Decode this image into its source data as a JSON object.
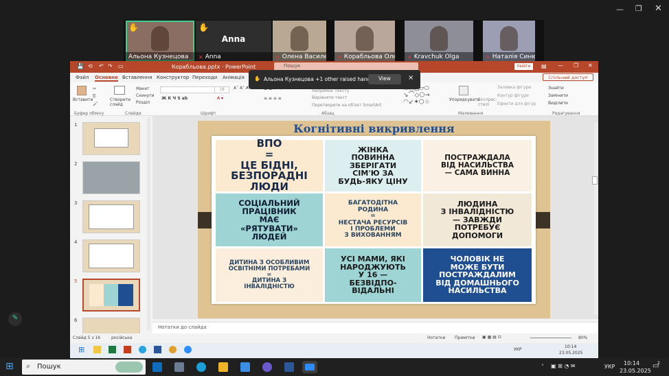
{
  "participants": [
    {
      "name": "Альона Кузнецова",
      "bg": "#8a6e62",
      "hand": true,
      "mic": false
    },
    {
      "name": "Anna",
      "bg": "#2e2e2e",
      "hand": true,
      "mic": true,
      "big": "Anna"
    },
    {
      "name": "Олена Василенко",
      "bg": "#b9a994",
      "hand": false,
      "mic": true
    },
    {
      "name": "Корабльова Олена",
      "bg": "#b8a79a",
      "hand": false,
      "mic": true
    },
    {
      "name": "Kravchuk Olga",
      "bg": "#8d8e98",
      "hand": false,
      "mic": true
    },
    {
      "name": "Наталія Синюк",
      "bg": "#9c9fb4",
      "hand": false,
      "mic": true
    }
  ],
  "ppt": {
    "title": "Корабльова.pptx · PowerPoint",
    "search": "Пошук",
    "signin": "Увійти",
    "share": "Спільний доступ",
    "tabs": [
      "Файл",
      "Основне",
      "Вставлення",
      "Конструктор",
      "Переходи",
      "Анімація"
    ],
    "notification": {
      "text": "Альона Кузнецова +1 other raised hands",
      "view": "View",
      "close": "×"
    },
    "ribbon": {
      "paste": "Вставити",
      "clipboard": "Буфер обміну",
      "new_slide": "Створити слайд",
      "layout": "Макет",
      "reset": "Скинути",
      "section": "Розділ",
      "slides": "Слайди",
      "font": "Шрифт",
      "paragraph": "Абзац",
      "text_dir": "Напрямок тексту",
      "align_text": "Вирівняти текст",
      "smartart": "Перетворити на об'єкт SmartArt",
      "arrange": "Упорядкувати",
      "quick_styles": "Експрес-стилі",
      "shape_fill": "Заливка фігури",
      "shape_outline": "Контур фігури",
      "shape_effects": "Ефекти для фігур",
      "drawing": "Малювання",
      "find": "Знайти",
      "replace": "Замінити",
      "select": "Виділити",
      "editing": "Редагування",
      "font_size": "18"
    },
    "slide_nums": [
      "1",
      "2",
      "3",
      "4",
      "5",
      "6"
    ],
    "slide": {
      "title": "Когнітивні викривлення",
      "cards": [
        {
          "text": "ВПО\n=\nЦЕ БІДНІ,\nБЕЗПОРАДНІ\nЛЮДИ",
          "bg": "#fbe9d0",
          "color": "#1a2b4a"
        },
        {
          "text": "ЖІНКА\nПОВИННА\nЗБЕРІГАТИ\nСІМ'Ю ЗА\nБУДЬ-ЯКУ ЦІНУ",
          "bg": "#ddeef0",
          "color": "#1a1a1a"
        },
        {
          "text": "ПОСТРАЖДАЛА\nВІД НАСИЛЬСТВА\n— САМА ВИННА",
          "bg": "#fbf0e4",
          "color": "#1a1a1a"
        },
        {
          "text": "СОЦІАЛЬНИЙ\nПРАЦІВНИК\nМАЄ\n«РЯТУВАТИ»\nЛЮДЕЙ",
          "bg": "#9ed4d4",
          "color": "#0e1c34"
        },
        {
          "text": "БАГАТОДІТНА\nРОДИНА\n=\nНЕСТАЧА РЕСУРСІВ\nІ ПРОБЛЕМИ\nЗ ВИХОВАННЯМ",
          "bg": "#fbe9d0",
          "color": "#2a4560"
        },
        {
          "text": "ЛЮДИНА\nЗ ІНВАЛІДНІСТЮ\n— ЗАВЖДИ\nПОТРЕБУЄ\nДОПОМОГИ",
          "bg": "#f2e8d8",
          "color": "#1a1a1a"
        },
        {
          "text": "ДИТИНА З ОСОБЛИВИМ\nОСВІТНІМИ ПОТРЕБАМИ\n=\nДИТИНА З\nІНВАЛІДНІСТЮ",
          "bg": "#fbeedc",
          "color": "#2a4560"
        },
        {
          "text": "УСІ МАМИ, ЯКІ\nНАРОДЖУЮТЬ\nУ 16 —\nБЕЗВІДПО-\nВІДАЛЬНІ",
          "bg": "#9ed4d4",
          "color": "#1a1a1a"
        },
        {
          "text": "ЧОЛОВІК НЕ\nМОЖЕ БУТИ\nПОСТРАЖДАЛИМ\nВІД ДОМАШНЬОГО\nНАСИЛЬСТВА",
          "bg": "#1f4e91",
          "color": "#ffffff"
        }
      ]
    },
    "notes": "Нотатки до слайда",
    "status": {
      "slide": "Слайд 5 з 16",
      "lang": "російська",
      "notes": "Нотатки",
      "comments": "Примітки",
      "zoom": "80%"
    }
  },
  "taskbar": {
    "search": "Пошук",
    "lang": "УКР",
    "time": "10:14",
    "date": "23.05.2025",
    "inner_time": "10:14",
    "inner_date": "23.05.2025",
    "inner_lang": "УКР",
    "badge": "2"
  }
}
